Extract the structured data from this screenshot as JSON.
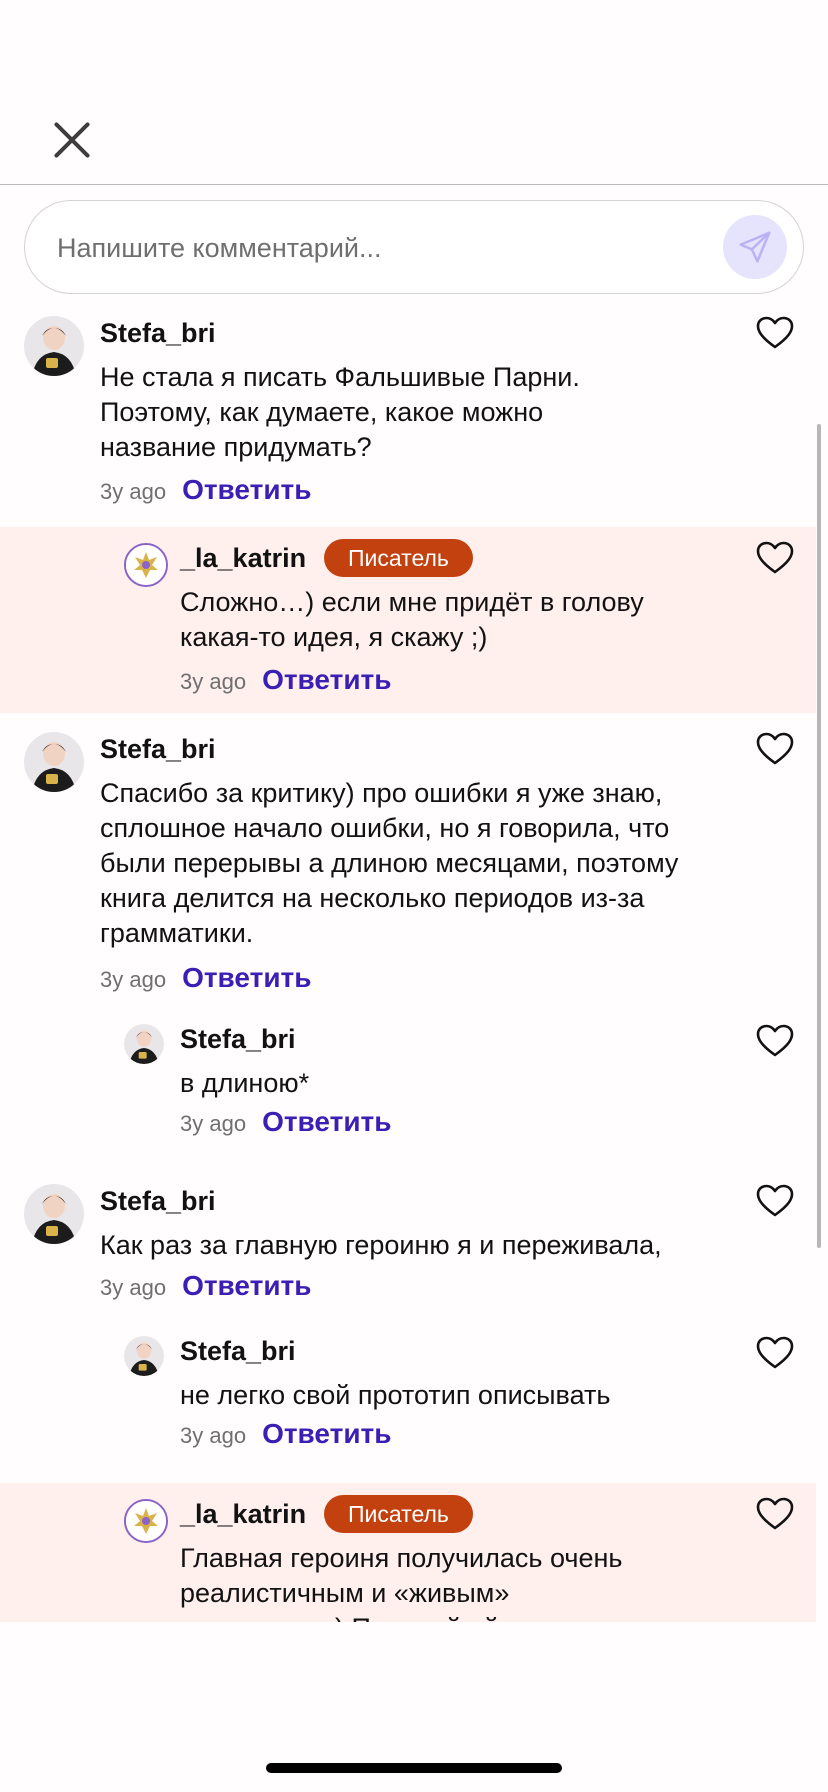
{
  "composer": {
    "placeholder": "Напишите комментарий..."
  },
  "reply_label": "Ответить",
  "colors": {
    "accent": "#3b1fb5",
    "badge": "#c3400f",
    "highlight": "#fff0ed"
  },
  "comments": [
    {
      "user": "Stefa_bri",
      "badge": "",
      "text": "Не стала я писать Фальшивые Парни. Поэтому, как думаете, какое можно название придумать?",
      "ago": "3y ago",
      "reply": "Ответить"
    },
    {
      "user": "_la_katrin",
      "badge": "Писатель",
      "text": "Сложно…) если мне придёт в голову какая-то идея, я скажу ;)",
      "ago": "3y ago",
      "reply": "Ответить"
    },
    {
      "user": "Stefa_bri",
      "badge": "",
      "text": "Спасибо за критику) про ошибки я уже знаю, сплошное начало ошибки, но я говорила, что были перерывы а длиною месяцами, поэтому книга делится на несколько периодов из-за грамматики.",
      "ago": "3y ago",
      "reply": "Ответить"
    },
    {
      "user": "Stefa_bri",
      "badge": "",
      "text": "в длиною*",
      "ago": "3y ago",
      "reply": "Ответить"
    },
    {
      "user": "Stefa_bri",
      "badge": "",
      "text": "Как раз за главную героиню я и переживала,",
      "ago": "3y ago",
      "reply": "Ответить"
    },
    {
      "user": "Stefa_bri",
      "badge": "",
      "text": "не легко свой прототип описывать",
      "ago": "3y ago",
      "reply": "Ответить"
    },
    {
      "user": "_la_katrin",
      "badge": "Писатель",
      "text": "Главная героиня получилась очень реалистичным и «живым» персонажем) Передай ей привет",
      "ago": "",
      "reply": ""
    }
  ]
}
